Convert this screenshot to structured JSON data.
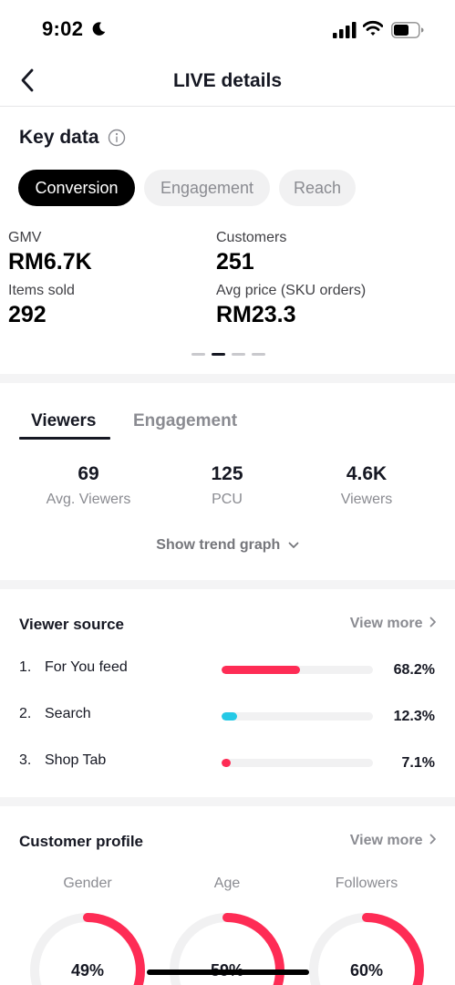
{
  "status_bar": {
    "time": "9:02"
  },
  "nav": {
    "title": "LIVE details"
  },
  "key_data": {
    "title": "Key data",
    "tabs": [
      {
        "label": "Conversion",
        "active": true
      },
      {
        "label": "Engagement",
        "active": false
      },
      {
        "label": "Reach",
        "active": false
      }
    ],
    "metrics": [
      {
        "label": "GMV",
        "value": "RM6.7K"
      },
      {
        "label": "Customers",
        "value": "251"
      },
      {
        "label": "Items sold",
        "value": "292"
      },
      {
        "label": "Avg price (SKU orders)",
        "value": "RM23.3"
      }
    ],
    "page_indicator": {
      "pages": 4,
      "active_index": 1
    }
  },
  "viewers": {
    "tabs": [
      {
        "label": "Viewers",
        "active": true
      },
      {
        "label": "Engagement",
        "active": false
      }
    ],
    "stats": [
      {
        "value": "69",
        "label": "Avg. Viewers"
      },
      {
        "value": "125",
        "label": "PCU"
      },
      {
        "value": "4.6K",
        "label": "Viewers"
      }
    ],
    "trend_link": "Show trend graph"
  },
  "viewer_source": {
    "title": "Viewer source",
    "view_more": "View more",
    "items": [
      {
        "rank": "1.",
        "name": "For You feed",
        "percent_label": "68.2%",
        "fraction": 0.52,
        "color": "#fe2c55"
      },
      {
        "rank": "2.",
        "name": "Search",
        "percent_label": "12.3%",
        "fraction": 0.1,
        "color": "#25c9e6"
      },
      {
        "rank": "3.",
        "name": "Shop Tab",
        "percent_label": "7.1%",
        "fraction": 0.06,
        "color": "#fe2c55"
      }
    ]
  },
  "customer_profile": {
    "title": "Customer profile",
    "view_more": "View more",
    "items": [
      {
        "label": "Gender",
        "value": "49%",
        "fraction": 0.49
      },
      {
        "label": "Age",
        "value": "59%",
        "fraction": 0.59
      },
      {
        "label": "Followers",
        "value": "60%",
        "fraction": 0.6
      }
    ]
  },
  "colors": {
    "accent": "#fe2c55",
    "cyan": "#25c9e6",
    "text": "#161823",
    "muted": "#8a8b91"
  }
}
